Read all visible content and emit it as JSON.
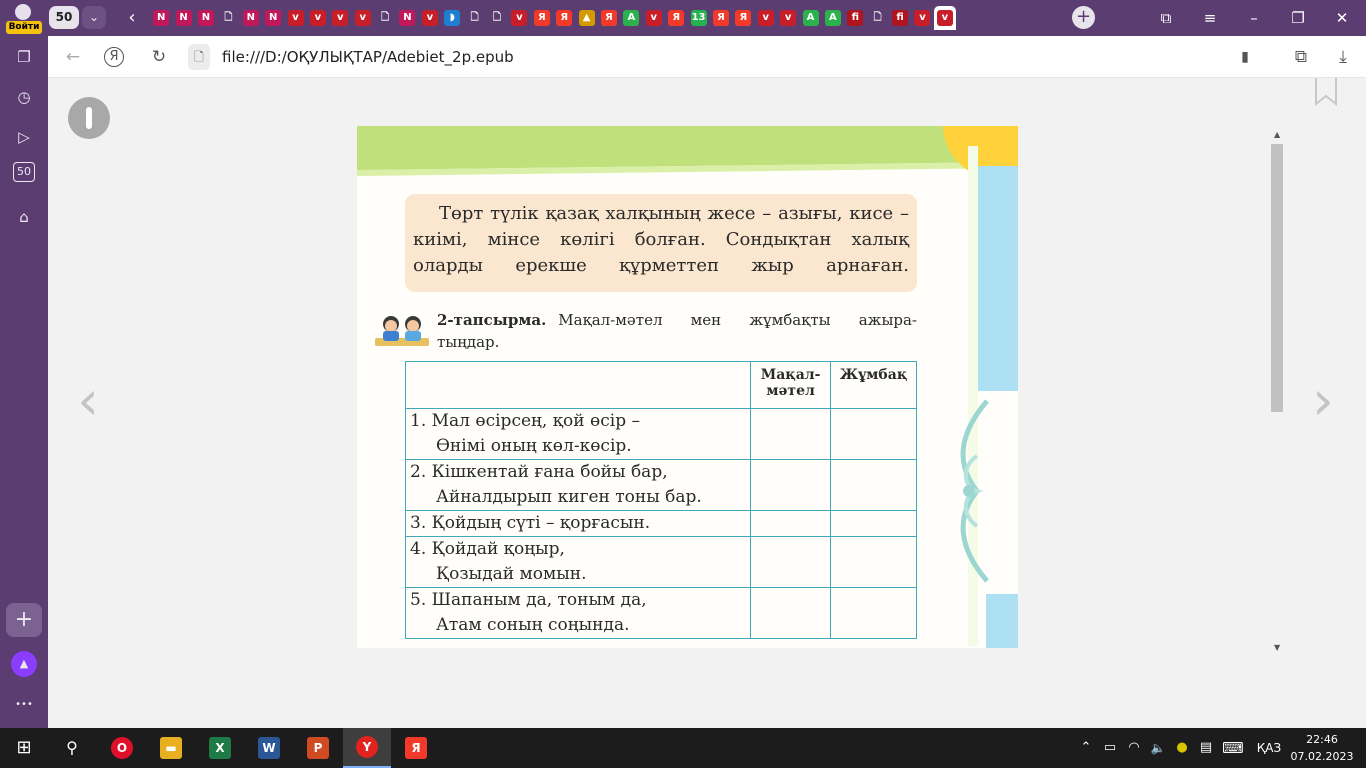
{
  "tabstrip": {
    "profile_label": "Войти",
    "tab_count": "50",
    "tab_dropdown_glyph": "⌄",
    "back_glyph": "‹",
    "new_tab_glyph": "+",
    "tabs": [
      {
        "icon": "nitro-pdf-icon",
        "glyph": "N",
        "color": "#c0185a"
      },
      {
        "icon": "nitro-pdf-icon",
        "glyph": "N",
        "color": "#c0185a"
      },
      {
        "icon": "nitro-pdf-icon",
        "glyph": "N",
        "color": "#c0185a"
      },
      {
        "icon": "file-icon",
        "glyph": "🗋",
        "color": "#5b3d72"
      },
      {
        "icon": "nitro-pdf-icon",
        "glyph": "N",
        "color": "#c0185a"
      },
      {
        "icon": "nitro-pdf-icon",
        "glyph": "N",
        "color": "#c0185a"
      },
      {
        "icon": "shield-app-icon",
        "glyph": "v",
        "color": "#c81e2a"
      },
      {
        "icon": "shield-app-icon",
        "glyph": "v",
        "color": "#c81e2a"
      },
      {
        "icon": "shield-app-icon",
        "glyph": "v",
        "color": "#c81e2a"
      },
      {
        "icon": "shield-app-icon",
        "glyph": "v",
        "color": "#c81e2a"
      },
      {
        "icon": "file-icon",
        "glyph": "🗋",
        "color": "#5b3d72"
      },
      {
        "icon": "nitro-pdf-icon",
        "glyph": "N",
        "color": "#c0185a"
      },
      {
        "icon": "shield-app-icon",
        "glyph": "v",
        "color": "#c81e2a"
      },
      {
        "icon": "globe-icon",
        "glyph": "◗",
        "color": "#1e7fd0"
      },
      {
        "icon": "file-icon",
        "glyph": "🗋",
        "color": "#5b3d72"
      },
      {
        "icon": "file-icon",
        "glyph": "🗋",
        "color": "#5b3d72"
      },
      {
        "icon": "shield-app-icon",
        "glyph": "v",
        "color": "#c81e2a"
      },
      {
        "icon": "yandex-icon",
        "glyph": "Я",
        "color": "#f33a2a"
      },
      {
        "icon": "yandex-icon",
        "glyph": "Я",
        "color": "#f33a2a"
      },
      {
        "icon": "image-icon",
        "glyph": "▲",
        "color": "#d49a00"
      },
      {
        "icon": "yandex-icon",
        "glyph": "Я",
        "color": "#f33a2a"
      },
      {
        "icon": "green-a-icon",
        "glyph": "A",
        "color": "#2bb24c"
      },
      {
        "icon": "shield-app-icon",
        "glyph": "v",
        "color": "#c81e2a"
      },
      {
        "icon": "yandex-icon",
        "glyph": "Я",
        "color": "#f33a2a"
      },
      {
        "icon": "whatsapp-icon",
        "glyph": "13",
        "color": "#25b350"
      },
      {
        "icon": "yandex-icon",
        "glyph": "Я",
        "color": "#f33a2a"
      },
      {
        "icon": "yandex-icon",
        "glyph": "Я",
        "color": "#f33a2a"
      },
      {
        "icon": "shield-app-icon",
        "glyph": "v",
        "color": "#c81e2a"
      },
      {
        "icon": "shield-app-icon",
        "glyph": "v",
        "color": "#c81e2a"
      },
      {
        "icon": "green-a-icon",
        "glyph": "A",
        "color": "#2bb24c"
      },
      {
        "icon": "green-a-icon",
        "glyph": "A",
        "color": "#2bb24c"
      },
      {
        "icon": "fi-icon",
        "glyph": "fi",
        "color": "#b0141e"
      },
      {
        "icon": "file-icon",
        "glyph": "🗋",
        "color": "#5b3d72"
      },
      {
        "icon": "fi-icon",
        "glyph": "fi",
        "color": "#b0141e"
      },
      {
        "icon": "shield-app-icon",
        "glyph": "v",
        "color": "#c81e2a"
      },
      {
        "icon": "shield-app-icon",
        "glyph": "v",
        "color": "#c81e2a",
        "active": true
      }
    ],
    "window_controls": {
      "bookmarks_glyph": "⧉",
      "menu_glyph": "≡",
      "minimize_glyph": "–",
      "restore_glyph": "❐",
      "close_glyph": "✕"
    }
  },
  "sidebar": {
    "items": [
      {
        "name": "collections-icon",
        "glyph": "❐"
      },
      {
        "name": "history-icon",
        "glyph": "◷"
      },
      {
        "name": "media-icon",
        "glyph": "▷"
      },
      {
        "name": "tabs-counter-icon",
        "glyph": "50"
      },
      {
        "name": "screenshot-icon",
        "glyph": "⌂"
      }
    ],
    "add_glyph": "+",
    "alice_glyph": "▲",
    "more_glyph": "•••"
  },
  "toolbar": {
    "back_glyph": "←",
    "yandex_glyph": "Я",
    "reload_glyph": "↻",
    "file_glyph": "🗋",
    "url": "file:///D:/ОҚУЛЫҚТАР/Adebiet_2p.epub",
    "bookmark_glyph": "▮",
    "extensions_glyph": "⧉",
    "download_glyph": "⤓"
  },
  "reader": {
    "prev_glyph": "‹",
    "next_glyph": "›",
    "scroll_up_glyph": "▲",
    "scroll_down_glyph": "▼",
    "scroll_position": 0.49,
    "intro_text": "Төрт түлік қазақ халқының жесе – азығы, кисе – киімі, мінсе көлігі болған. Сондықтан халық оларды ерекше құрметтеп жыр арнаған.",
    "task": {
      "number": "2-тапсырма.",
      "line1": "Мақал-мәтел мен жұмбақты ажыра-",
      "line2": "тыңдар."
    },
    "table": {
      "headers": [
        "",
        "Мақал-\nмәтел",
        "Жұмбақ"
      ],
      "rows": [
        {
          "l1": "1. Мал өсірсең, қой өсір –",
          "l2": "Өнімі оның көл-көсір."
        },
        {
          "l1": "2. Кішкентай ғана бойы бар,",
          "l2": "Айналдырып киген тоны бар."
        },
        {
          "l1": "3. Қойдың сүті – қорғасын.",
          "l2": ""
        },
        {
          "l1": "4. Қойдай қоңыр,",
          "l2": "Қозыдай момын."
        },
        {
          "l1": "5. Шапаным да, тоным да,",
          "l2": "Атам соның соңында."
        }
      ]
    },
    "colors": {
      "intro_bg": "#fbe7cf",
      "top_band": "#bfe07a",
      "corner": "#ffd23c",
      "side_band": "#aee0f4",
      "table_border": "#40a8b8"
    }
  },
  "taskbar": {
    "start_glyph": "⊞",
    "search_glyph": "⚲",
    "apps": [
      {
        "icon": "opera-icon",
        "glyph": "O",
        "color": "#e0102a"
      },
      {
        "icon": "explorer-icon",
        "glyph": "▬",
        "color": "#e8b020"
      },
      {
        "icon": "excel-icon",
        "glyph": "X",
        "color": "#1e7b45"
      },
      {
        "icon": "word-icon",
        "glyph": "W",
        "color": "#2b5797"
      },
      {
        "icon": "powerpoint-icon",
        "glyph": "P",
        "color": "#d04a22"
      },
      {
        "icon": "yandex-browser-icon",
        "glyph": "Y",
        "color": "#e0231e",
        "active": true
      },
      {
        "icon": "yandex-icon",
        "glyph": "Я",
        "color": "#f33a2a"
      }
    ],
    "tray": {
      "chevron_glyph": "⌃",
      "battery_glyph": "▭",
      "wifi_glyph": "◠",
      "volume_glyph": "🔈",
      "update_glyph": "●",
      "notify_glyph": "▤",
      "keyboard_glyph": "⌨",
      "language": "ҚАЗ",
      "time": "22:46",
      "date": "07.02.2023"
    }
  }
}
